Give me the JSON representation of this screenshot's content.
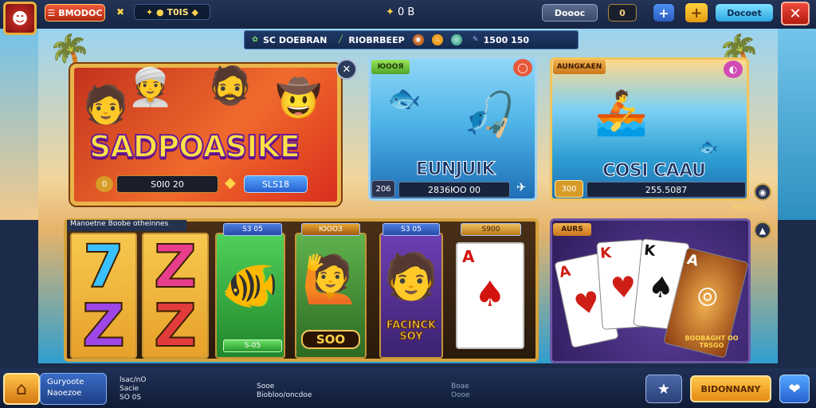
{
  "topbar": {
    "crest_icon": "☻",
    "menu_label": "ВMODOC",
    "coin_value": "T0IS",
    "gem_value": "0 B",
    "gray_button": "Doooc",
    "pause_label": "0",
    "plus_label": "+",
    "add_label": "+",
    "cyan_button": "Docoet",
    "close_label": "✕"
  },
  "categories": [
    {
      "icon": "crab-icon",
      "label": "SC DOEBRAN"
    },
    {
      "icon": "rod-icon",
      "label": "RIOBRBEEP"
    },
    {
      "icon": "shell-icon",
      "label": ""
    },
    {
      "icon": "fire-icon",
      "label": ""
    },
    {
      "icon": "globe-icon",
      "label": ""
    },
    {
      "icon": "ticket-icon",
      "label": "1500 150"
    }
  ],
  "featured": {
    "title": "SADPOASIKE",
    "value": "S0I0 20",
    "button": "SLS18",
    "coin_label": "0",
    "close_label": "✕"
  },
  "fish_card_1": {
    "tag": "ЮООЯ",
    "title": "EUNJUIK",
    "chip": "206",
    "value": "2836ЮО 00",
    "fav": "◯"
  },
  "fish_card_2": {
    "tag": "AUNGKAEN",
    "title": "COSI CAAU",
    "chip": "300",
    "value": "255.5087",
    "fav": "◐"
  },
  "slot": {
    "label": "Manoetne Boobe otheinnes",
    "reel_tops": [
      "S3 05",
      "ЮООЗ",
      "S3 05",
      "S900"
    ],
    "reel_bottoms": [
      "S-05"
    ],
    "center_label": "SOO",
    "cast_caption": "FACINCK SOY",
    "card_letter": "A"
  },
  "poker": {
    "tag": "AURS",
    "caption": "BOOBAGHT OO TRSGO",
    "cards": [
      "A",
      "K",
      "K",
      "A"
    ]
  },
  "side": {
    "text": "ЕООООО"
  },
  "bottombar": {
    "profile_line1": "Guryoote",
    "profile_line2": "Naoezoe",
    "stat1_line1": "lsac/nO",
    "stat1_line2": "Sacie",
    "stat1_line3": "SO 0S",
    "stat2_line1": "Sooe",
    "stat2_line2": "Biobloo/oncdoe",
    "stat3_line1": "Boae",
    "stat3_line2": "Oooe",
    "big_button": "BIDONNANY",
    "star_icon": "★",
    "heart_icon": "❤"
  }
}
